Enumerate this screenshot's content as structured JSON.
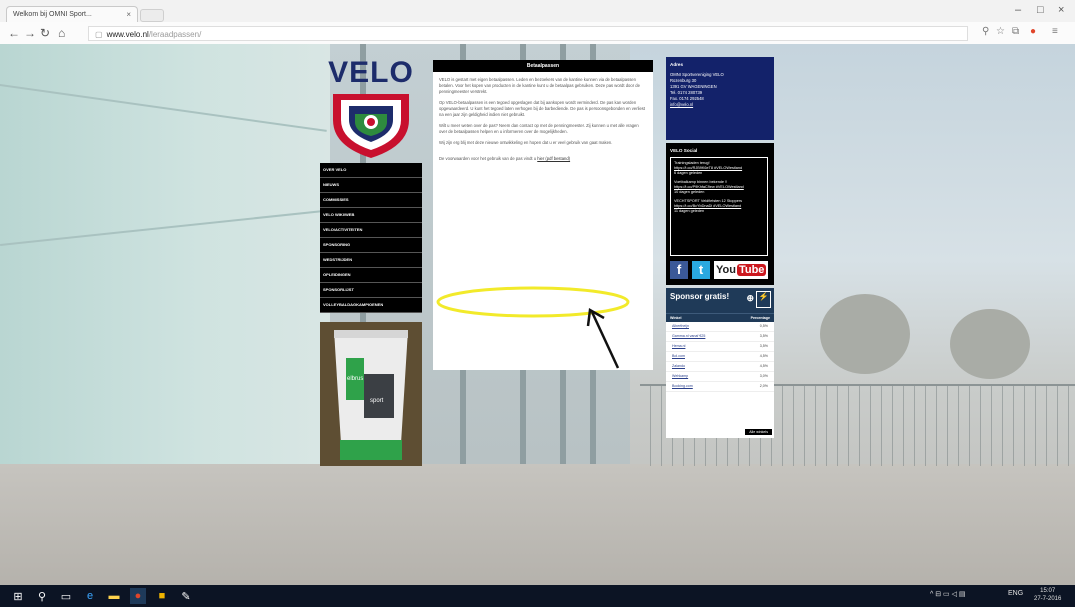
{
  "browser": {
    "tab_title": "Welkom bij OMNI Sport...",
    "tab_close": "×",
    "url_domain": "www.velo.nl",
    "url_path": "/leraadpassen/",
    "window_controls": [
      "–",
      "□",
      "×"
    ]
  },
  "logo": {
    "text": "VELO"
  },
  "menu": {
    "items": [
      "OVER VELO",
      "NIEUWS",
      "COMMISSIES",
      "VELO WIKI/WEB",
      "VELO/ACTIVITEITEN",
      "SPONSORING",
      "WEDSTRIJDEN",
      "OPLEIDINGEN",
      "SPONSORLIJST",
      "VOLLEYBALDAGKAMPIOENEN"
    ]
  },
  "promo": {
    "brand_a": "elbrus",
    "brand_b": "sport"
  },
  "content": {
    "title": "Betaalpassen",
    "paragraphs": [
      "VELO is gestart met eigen betaalpassen. Leden en bezoekers van de kantine kunnen via de betaalpassen betalen. Voor het kopen van producten in de kantine kunt u de betaalpas gebruiken. Deze pas wordt door de penningmeester verstrekt.",
      "Op VELO-betaalpassen is een tegoed opgeslagen dat bij aankopen wordt verminderd. De pas kan worden opgewaardeerd. U kunt het tegoed laten verhogen bij de barbediende. De pas is persoonsgebonden en verliest na een jaar zijn geldigheid indien niet gebruikt.",
      "Wilt u meer weten over de pas? Neem dan contact op met de penningmeester. Zij kunnen u met alle vragen over de betaalpassen helpen en u informeren over de mogelijkheden.",
      "Wij zijn erg blij met deze nieuwe ontwikkeling en hopen dat u er veel gebruik van gaat maken."
    ],
    "link_prefix": "De voorwaarden voor het gebruik van de pas vindt u",
    "link_text": "hier (pdf bestand)"
  },
  "address": {
    "title": "Adres",
    "lines": [
      "OMNI Sportvereniging VELO",
      "Rozenburg 30",
      "1391 GV WAGENINGEN",
      "Tel. 0174 280739",
      "Fax. 0174 292548",
      "info@velo.nl"
    ]
  },
  "social": {
    "title": "VELO Social",
    "posts": [
      "Trainingsladen terug!",
      "https://t.co/RJB9K6eT8 #VELOWestland",
      "6 dagen geleden",
      "Voetbalkamp binnen bekende !!",
      "https://t.co/P9KhfaC9ew #VELOWestland",
      "10 dagen geleden",
      "VECHTSPORT Veldfietsten 12 Stoppers",
      "https://t.co/BcYbDnaDi #VELOWestland",
      "11 dagen geleden"
    ],
    "fb": "f",
    "tw": "t",
    "yt_you": "You",
    "yt_tube": "Tube"
  },
  "sponsor": {
    "title": "Sponsor gratis!",
    "col_a": "Winkel",
    "col_b": "Percentage",
    "rows": [
      {
        "name": "Albertheijn",
        "pct": "0,5%"
      },
      {
        "name": "Gamma.nl vanaf €25",
        "pct": "3,5%"
      },
      {
        "name": "Hema.nl",
        "pct": "3,5%"
      },
      {
        "name": "Bol.com",
        "pct": "4,5%"
      },
      {
        "name": "Zalando",
        "pct": "4,5%"
      },
      {
        "name": "Wehkamp",
        "pct": "3,0%"
      },
      {
        "name": "Booking.com",
        "pct": "2,0%"
      }
    ],
    "btn": "Alle winkels"
  },
  "taskbar": {
    "time": "15:07",
    "date": "27-7-2016",
    "lang": "ENG"
  }
}
